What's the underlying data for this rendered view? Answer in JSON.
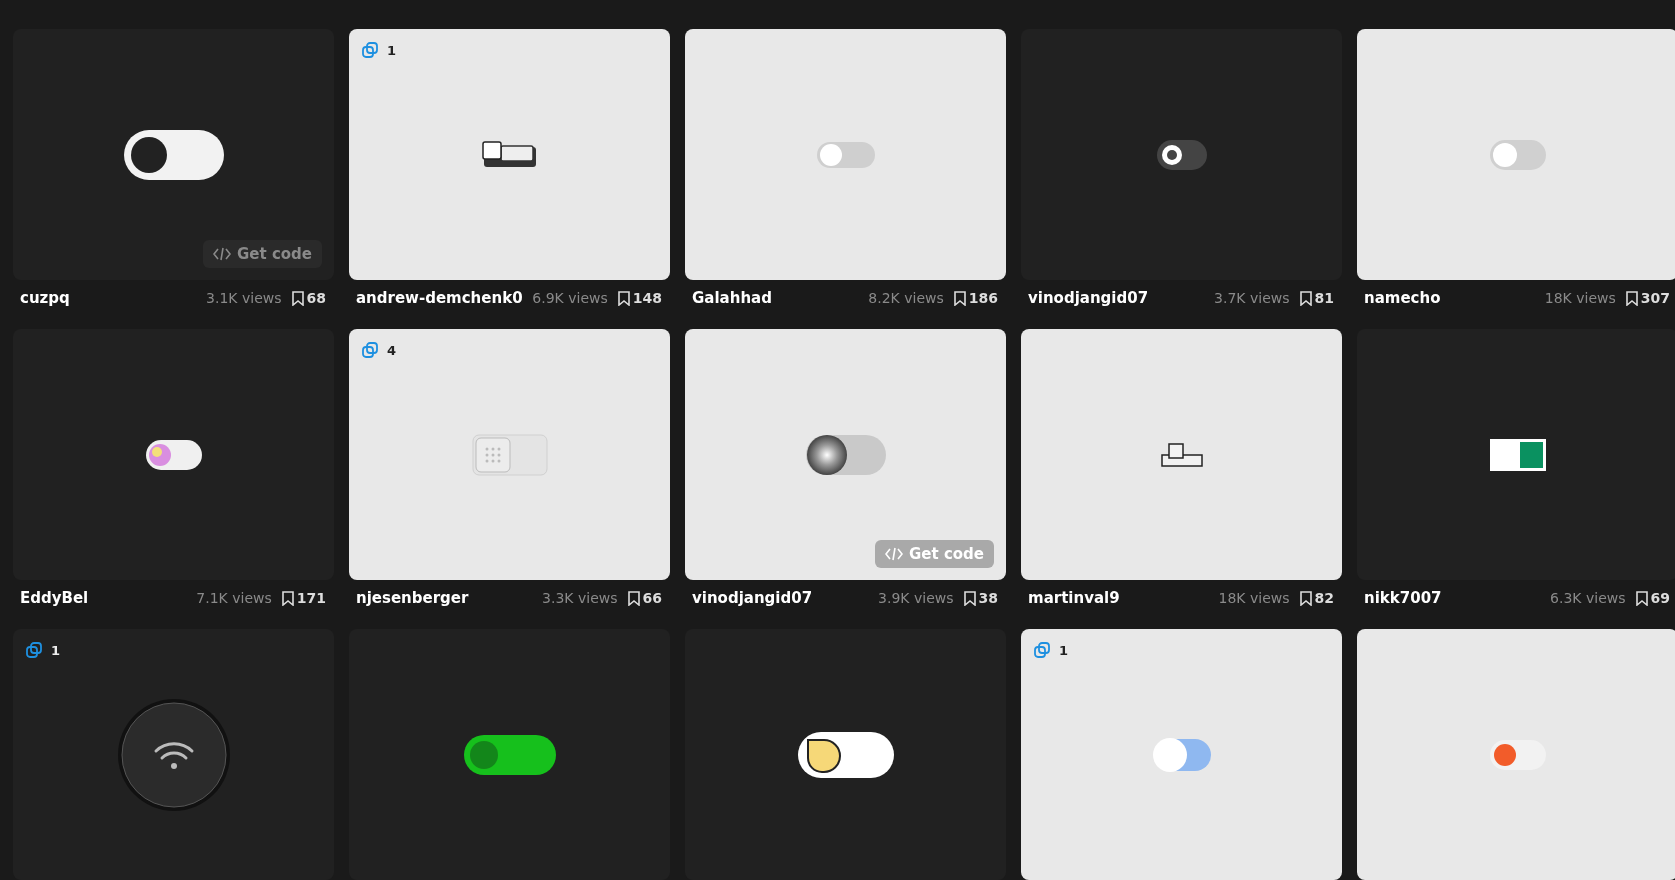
{
  "cards": [
    {
      "kind": "dark",
      "get_code": "Get code",
      "toggle": {
        "kind": "big-white",
        "on": false
      },
      "author": "cuzpq",
      "views": "3.1K views",
      "saves": "68"
    },
    {
      "kind": "light",
      "badge": "1",
      "toggle": {
        "kind": "boxy",
        "on": false
      },
      "author": "andrew-demchenk0",
      "views": "6.9K views",
      "saves": "148"
    },
    {
      "kind": "light",
      "toggle": {
        "kind": "soft",
        "on": false
      },
      "author": "Galahhad",
      "views": "8.2K views",
      "saves": "186"
    },
    {
      "kind": "dark",
      "toggle": {
        "kind": "ring",
        "on": false
      },
      "author": "vinodjangid07",
      "views": "3.7K views",
      "saves": "81"
    },
    {
      "kind": "light",
      "toggle": {
        "kind": "soft-gray",
        "on": false
      },
      "author": "namecho",
      "views": "18K views",
      "saves": "307"
    },
    {
      "kind": "dark",
      "toggle": {
        "kind": "glow",
        "on": false
      },
      "author": "EddyBel",
      "views": "7.1K views",
      "saves": "171"
    },
    {
      "kind": "light",
      "badge": "4",
      "toggle": {
        "kind": "neumorph",
        "on": false
      },
      "author": "njesenberger",
      "views": "3.3K views",
      "saves": "66"
    },
    {
      "kind": "light",
      "get_code": "Get code",
      "toggle": {
        "kind": "metal",
        "on": false
      },
      "author": "vinodjangid07",
      "views": "3.9K views",
      "saves": "38"
    },
    {
      "kind": "light",
      "toggle": {
        "kind": "outline",
        "on": false
      },
      "author": "martinval9",
      "views": "18K views",
      "saves": "82"
    },
    {
      "kind": "dark",
      "toggle": {
        "kind": "green-square",
        "on": true
      },
      "author": "nikk7007",
      "views": "6.3K views",
      "saves": "69"
    },
    {
      "kind": "dark",
      "badge": "1",
      "toggle": {
        "kind": "wifi",
        "on": false
      }
    },
    {
      "kind": "dark",
      "toggle": {
        "kind": "green-pill",
        "on": false
      }
    },
    {
      "kind": "dark",
      "toggle": {
        "kind": "yellow",
        "on": false
      }
    },
    {
      "kind": "light",
      "badge": "1",
      "toggle": {
        "kind": "blue",
        "on": false
      }
    },
    {
      "kind": "light",
      "toggle": {
        "kind": "orange",
        "on": false
      }
    }
  ]
}
